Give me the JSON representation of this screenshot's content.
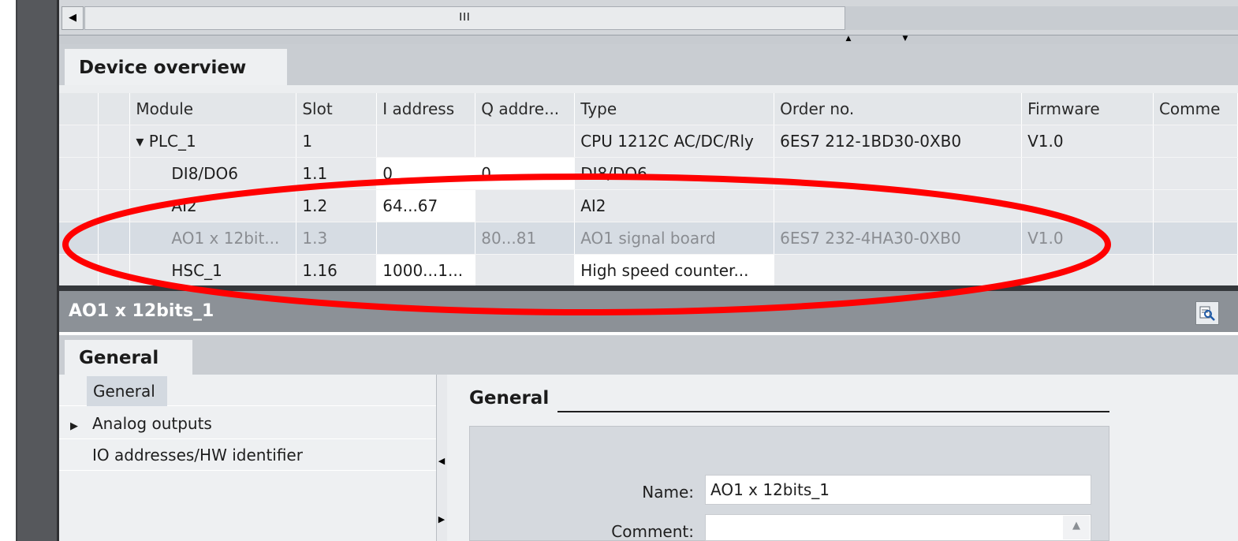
{
  "scrollbar": {
    "thumb_grip": "III",
    "left_arrow": "◀",
    "split_up": "▲",
    "split_down": "▼"
  },
  "device_overview": {
    "tab_label": "Device overview",
    "columns": [
      "",
      "",
      "Module",
      "Slot",
      "I address",
      "Q addre...",
      "Type",
      "Order no.",
      "Firmware",
      "Comme"
    ],
    "rows": [
      {
        "module": "▾ PLC_1",
        "slot": "1",
        "i_address": "",
        "q_address": "",
        "type": "CPU 1212C AC/DC/Rly",
        "order_no": "6ES7 212-1BD30-0XB0",
        "firmware": "V1.0",
        "comment": ""
      },
      {
        "module": "DI8/DO6",
        "slot": "1.1",
        "i_address": "0",
        "q_address": "0",
        "type": "DI8/DO6",
        "order_no": "",
        "firmware": "",
        "comment": ""
      },
      {
        "module": "AI2",
        "slot": "1.2",
        "i_address": "64...67",
        "q_address": "",
        "type": "AI2",
        "order_no": "",
        "firmware": "",
        "comment": ""
      },
      {
        "module": "AO1 x 12bit...",
        "slot": "1.3",
        "i_address": "",
        "q_address": "80...81",
        "type": "AO1 signal board",
        "order_no": "6ES7 232-4HA30-0XB0",
        "firmware": "V1.0",
        "comment": ""
      },
      {
        "module": "HSC_1",
        "slot": "1.16",
        "i_address": "1000...1...",
        "q_address": "",
        "type": "High speed counter...",
        "order_no": "",
        "firmware": "",
        "comment": ""
      }
    ]
  },
  "properties": {
    "title": "AO1 x 12bits_1",
    "zoom_icon": "search-icon",
    "tab_label": "General",
    "nav_items": [
      "General",
      "Analog outputs",
      "IO addresses/HW identifier"
    ],
    "nav_expand_glyph": "▶",
    "section_title": "General",
    "name_label": "Name:",
    "name_value": "AO1 x 12bits_1",
    "comment_label": "Comment:",
    "comment_value": ""
  },
  "colors": {
    "highlight_ellipse": "#ff0000",
    "selected_row": "#d6dce3"
  }
}
